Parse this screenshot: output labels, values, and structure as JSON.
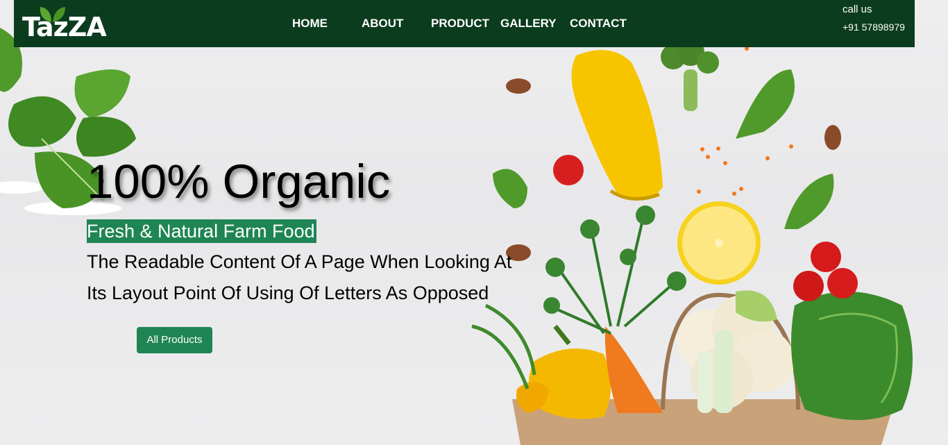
{
  "brand": {
    "name": "TazZA"
  },
  "nav": {
    "items": [
      {
        "label": "HOME"
      },
      {
        "label": "ABOUT"
      },
      {
        "label": "PRODUCT"
      },
      {
        "label": "GALLERY"
      },
      {
        "label": "CONTACT"
      }
    ]
  },
  "contact": {
    "call_label": "call us",
    "phone": "+91 57898979"
  },
  "hero": {
    "headline": "100% Organic",
    "tagline": "Fresh & Natural Farm Food",
    "description_line1": "The Readable Content Of A Page When Looking At",
    "description_line2": "Its Layout Point Of Using Of Letters As Opposed",
    "cta_label": "All Products"
  },
  "colors": {
    "nav_bg": "#0b3c1e",
    "accent_green": "#1f8554",
    "text": "#000000"
  },
  "icons": [
    "leaf-logo-icon"
  ]
}
